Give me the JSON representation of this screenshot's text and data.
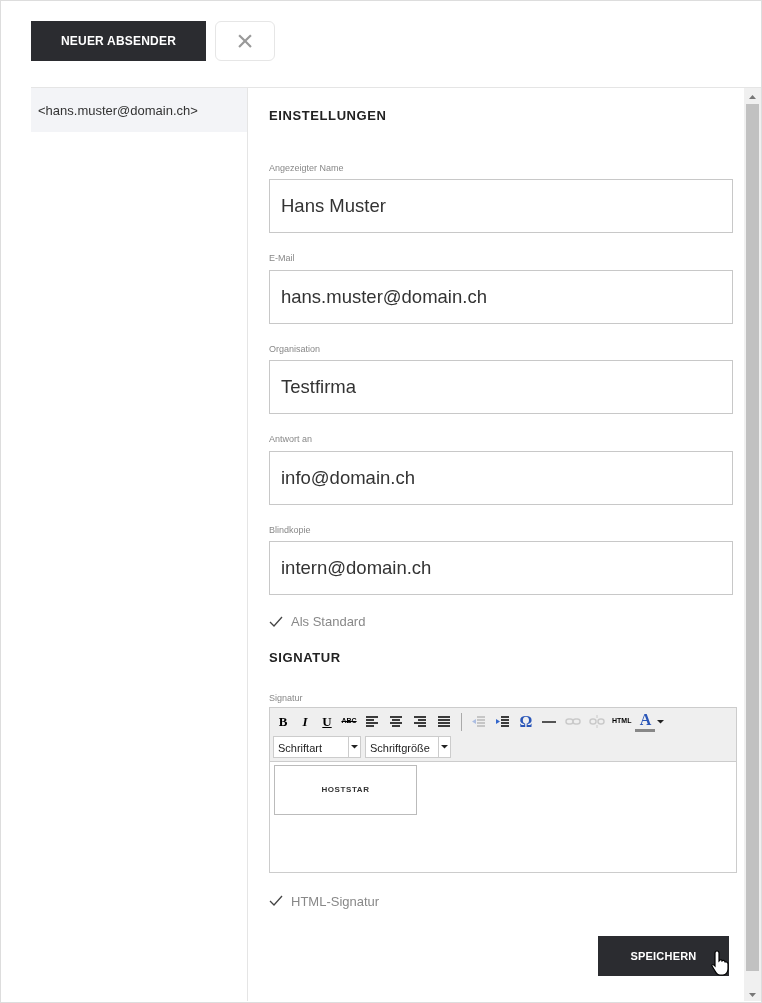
{
  "toolbar": {
    "new_sender_button": "NEUER ABSENDER",
    "close_button": "×"
  },
  "senders": [
    {
      "label": "<hans.muster@domain.ch>",
      "selected": true
    }
  ],
  "settings": {
    "heading": "EINSTELLUNGEN",
    "fields": [
      {
        "label": "Angezeigter Name",
        "value": "Hans Muster"
      },
      {
        "label": "E-Mail",
        "value": "hans.muster@domain.ch"
      },
      {
        "label": "Organisation",
        "value": "Testfirma"
      },
      {
        "label": "Antwort an",
        "value": "info@domain.ch"
      },
      {
        "label": "Blindkopie",
        "value": "intern@domain.ch"
      }
    ],
    "default_option": {
      "label": "Als Standard",
      "checked": true
    }
  },
  "signature": {
    "heading": "SIGNATUR",
    "label": "Signatur",
    "editor_tools": [
      {
        "kind": "text",
        "label": "B",
        "disabled": false
      },
      {
        "kind": "text",
        "label": "I",
        "disabled": false
      },
      {
        "kind": "text",
        "label": "U",
        "disabled": false
      },
      {
        "kind": "text",
        "label": "ABC",
        "disabled": false
      },
      {
        "kind": "icon",
        "disabled": false
      },
      {
        "kind": "icon",
        "disabled": false
      },
      {
        "kind": "icon",
        "disabled": false
      },
      {
        "kind": "icon",
        "disabled": false
      },
      {
        "kind": "separator"
      },
      {
        "kind": "icon",
        "disabled": true
      },
      {
        "kind": "icon",
        "disabled": false
      },
      {
        "kind": "text",
        "label": "Ω",
        "disabled": false
      },
      {
        "kind": "icon",
        "disabled": false
      },
      {
        "kind": "icon",
        "disabled": true
      },
      {
        "kind": "icon",
        "disabled": true
      },
      {
        "kind": "text",
        "label": "HTML",
        "disabled": false
      },
      {
        "kind": "text",
        "label": "A",
        "disabled": false
      }
    ],
    "dropdowns": [
      "Schriftart",
      "Schriftgröße"
    ],
    "logo_text": "HOSTSTAR",
    "html_option": {
      "label": "HTML-Signatur",
      "checked": true
    }
  },
  "save_button": "SPEICHERN"
}
